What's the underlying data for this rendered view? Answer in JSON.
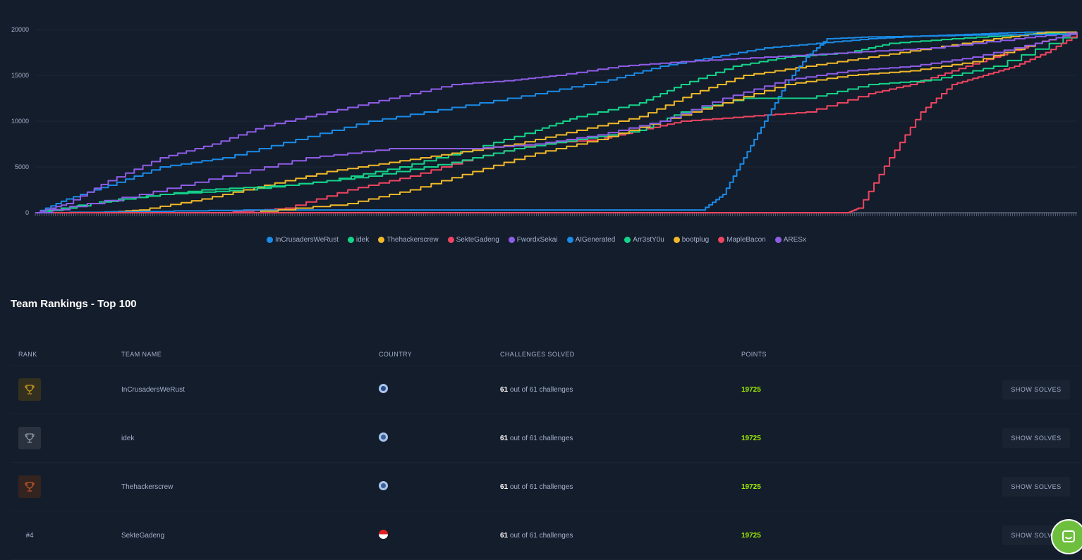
{
  "chart_data": {
    "type": "line",
    "title": "",
    "xlabel": "",
    "ylabel": "",
    "ylim": [
      0,
      20000
    ],
    "yticks": [
      0,
      5000,
      10000,
      15000,
      20000
    ],
    "xlim": [
      0,
      100
    ],
    "grid": true,
    "legend": "bottom",
    "series": [
      {
        "name": "InCrusadersWeRust",
        "color": "#1a8be8",
        "x": [
          0,
          3,
          7,
          12,
          18,
          25,
          32,
          40,
          48,
          55,
          60,
          65,
          70,
          75,
          80,
          85,
          90,
          95,
          100
        ],
        "y": [
          0,
          1500,
          3000,
          5000,
          6000,
          8000,
          10000,
          11500,
          13000,
          14500,
          16000,
          17000,
          18000,
          18500,
          19000,
          19300,
          19500,
          19725,
          19725
        ]
      },
      {
        "name": "idek",
        "color": "#14d38a",
        "x": [
          0,
          5,
          12,
          20,
          28,
          35,
          42,
          48,
          52,
          58,
          62,
          67,
          72,
          78,
          82,
          88,
          95,
          100
        ],
        "y": [
          0,
          1000,
          2000,
          2500,
          3500,
          5000,
          7000,
          9000,
          10500,
          12000,
          14000,
          16000,
          17000,
          17500,
          18500,
          19000,
          19500,
          19725
        ]
      },
      {
        "name": "Thehackerscrew",
        "color": "#f1b92a",
        "x": [
          0,
          6,
          10,
          16,
          22,
          28,
          34,
          40,
          46,
          52,
          58,
          63,
          68,
          74,
          80,
          86,
          92,
          97,
          100
        ],
        "y": [
          0,
          0,
          300,
          1500,
          3000,
          4500,
          5500,
          6500,
          7500,
          9000,
          10500,
          13000,
          15000,
          16000,
          17000,
          18000,
          19000,
          19725,
          19725
        ]
      },
      {
        "name": "SekteGadeng",
        "color": "#ef4561",
        "x": [
          0,
          18,
          24,
          30,
          36,
          42,
          48,
          54,
          58,
          62,
          68,
          74,
          80,
          84,
          88,
          92,
          96,
          100
        ],
        "y": [
          0,
          0,
          500,
          2500,
          4000,
          6000,
          7500,
          8000,
          9000,
          10000,
          10500,
          11000,
          13000,
          14000,
          15500,
          17000,
          18500,
          19725
        ]
      },
      {
        "name": "FwordxSekai",
        "color": "#8e5de8",
        "x": [
          0,
          3,
          7,
          12,
          17,
          22,
          28,
          34,
          40,
          46,
          50,
          56,
          62,
          70,
          78,
          86,
          94,
          100
        ],
        "y": [
          0,
          1000,
          3500,
          6000,
          7500,
          9500,
          11000,
          12500,
          14000,
          14500,
          15000,
          16000,
          16500,
          17000,
          17500,
          18000,
          19000,
          19725
        ]
      },
      {
        "name": "AIGenerated",
        "color": "#1a8be8",
        "x": [
          0,
          20,
          40,
          60,
          64,
          66,
          68,
          70,
          72,
          74,
          76,
          80,
          90,
          100
        ],
        "y": [
          0,
          300,
          300,
          300,
          300,
          2000,
          6000,
          10000,
          14000,
          17000,
          19000,
          19200,
          19400,
          19500
        ]
      },
      {
        "name": "Arr3stY0u",
        "color": "#14d38a",
        "x": [
          0,
          8,
          16,
          24,
          32,
          40,
          46,
          52,
          58,
          62,
          68,
          74,
          80,
          86,
          92,
          100
        ],
        "y": [
          0,
          1500,
          2500,
          3000,
          4000,
          5500,
          7000,
          8000,
          9000,
          11000,
          12500,
          12500,
          14000,
          14500,
          16000,
          19725
        ]
      },
      {
        "name": "bootplug",
        "color": "#f1b92a",
        "x": [
          0,
          20,
          30,
          36,
          42,
          48,
          54,
          60,
          66,
          72,
          78,
          84,
          90,
          96,
          100
        ],
        "y": [
          0,
          0,
          1000,
          2500,
          4500,
          6500,
          8000,
          10000,
          12000,
          14000,
          15000,
          15500,
          16500,
          18500,
          19725
        ]
      },
      {
        "name": "MapleBacon",
        "color": "#ef4561",
        "x": [
          0,
          40,
          60,
          78,
          79,
          82,
          85,
          88,
          91,
          94,
          97,
          100
        ],
        "y": [
          0,
          0,
          0,
          0,
          500,
          6000,
          11000,
          14000,
          15000,
          16000,
          17500,
          19500
        ]
      },
      {
        "name": "ARESx",
        "color": "#8e5de8",
        "x": [
          0,
          10,
          18,
          26,
          34,
          42,
          48,
          54,
          60,
          66,
          72,
          78,
          84,
          90,
          96,
          100
        ],
        "y": [
          0,
          2000,
          4000,
          6000,
          7000,
          7000,
          7500,
          8500,
          10000,
          12500,
          14500,
          15500,
          16000,
          17000,
          18500,
          19725
        ]
      }
    ]
  },
  "legend": [
    {
      "label": "InCrusadersWeRust",
      "color": "#1a8be8"
    },
    {
      "label": "idek",
      "color": "#14d38a"
    },
    {
      "label": "Thehackerscrew",
      "color": "#f1b92a"
    },
    {
      "label": "SekteGadeng",
      "color": "#ef4561"
    },
    {
      "label": "FwordxSekai",
      "color": "#8e5de8"
    },
    {
      "label": "AIGenerated",
      "color": "#1a8be8"
    },
    {
      "label": "Arr3stY0u",
      "color": "#14d38a"
    },
    {
      "label": "bootplug",
      "color": "#f1b92a"
    },
    {
      "label": "MapleBacon",
      "color": "#ef4561"
    },
    {
      "label": "ARESx",
      "color": "#8e5de8"
    }
  ],
  "rankings": {
    "title": "Team Rankings - Top 100",
    "headers": {
      "rank": "RANK",
      "team": "TEAM NAME",
      "country": "COUNTRY",
      "solved": "CHALLENGES SOLVED",
      "points": "POINTS"
    },
    "rows": [
      {
        "rank": "",
        "rank_style": "gold",
        "team": "InCrusadersWeRust",
        "flag_color": "#2b4a8a",
        "solved": "61",
        "solved_suffix": "out of 61 challenges",
        "points": "19725",
        "action": "SHOW SOLVES"
      },
      {
        "rank": "",
        "rank_style": "silver",
        "team": "idek",
        "flag_color": "#3a5f9a",
        "solved": "61",
        "solved_suffix": "out of 61 challenges",
        "points": "19725",
        "action": "SHOW SOLVES"
      },
      {
        "rank": "",
        "rank_style": "bronze",
        "team": "Thehackerscrew",
        "flag_color": "#3a5f9a",
        "solved": "61",
        "solved_suffix": "out of 61 challenges",
        "points": "19725",
        "action": "SHOW SOLVES"
      },
      {
        "rank": "#4",
        "rank_style": "plain",
        "team": "SekteGadeng",
        "flag_color": "#e02020",
        "solved": "61",
        "solved_suffix": "out of 61 challenges",
        "points": "19725",
        "action": "SHOW SOLVES"
      }
    ]
  }
}
